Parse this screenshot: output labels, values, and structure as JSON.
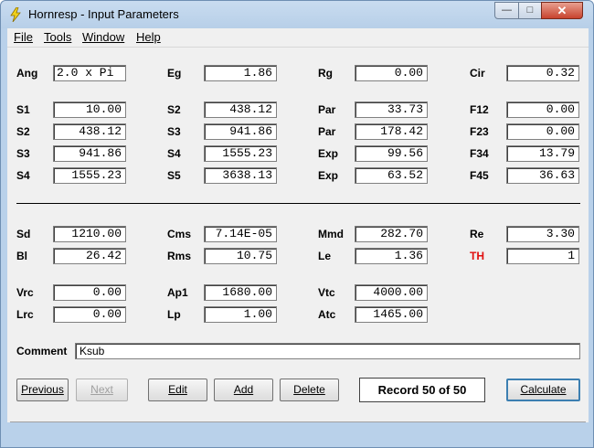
{
  "window": {
    "title": "Hornresp - Input Parameters"
  },
  "menu": [
    {
      "label": "File"
    },
    {
      "label": "Tools"
    },
    {
      "label": "Window"
    },
    {
      "label": "Help"
    }
  ],
  "horn": {
    "row0": [
      {
        "label": "Ang",
        "value": "2.0 x Pi"
      },
      {
        "label": "Eg",
        "value": "1.86"
      },
      {
        "label": "Rg",
        "value": "0.00"
      },
      {
        "label": "Cir",
        "value": "0.32"
      }
    ],
    "rows": [
      [
        {
          "label": "S1",
          "value": "10.00"
        },
        {
          "label": "S2",
          "value": "438.12"
        },
        {
          "label": "Par",
          "value": "33.73"
        },
        {
          "label": "F12",
          "value": "0.00"
        }
      ],
      [
        {
          "label": "S2",
          "value": "438.12"
        },
        {
          "label": "S3",
          "value": "941.86"
        },
        {
          "label": "Par",
          "value": "178.42"
        },
        {
          "label": "F23",
          "value": "0.00"
        }
      ],
      [
        {
          "label": "S3",
          "value": "941.86"
        },
        {
          "label": "S4",
          "value": "1555.23"
        },
        {
          "label": "Exp",
          "value": "99.56"
        },
        {
          "label": "F34",
          "value": "13.79"
        }
      ],
      [
        {
          "label": "S4",
          "value": "1555.23"
        },
        {
          "label": "S5",
          "value": "3638.13"
        },
        {
          "label": "Exp",
          "value": "63.52"
        },
        {
          "label": "F45",
          "value": "36.63"
        }
      ]
    ]
  },
  "driver": {
    "rows": [
      [
        {
          "label": "Sd",
          "value": "1210.00"
        },
        {
          "label": "Cms",
          "value": "7.14E-05"
        },
        {
          "label": "Mmd",
          "value": "282.70"
        },
        {
          "label": "Re",
          "value": "3.30"
        }
      ],
      [
        {
          "label": "Bl",
          "value": "26.42"
        },
        {
          "label": "Rms",
          "value": "10.75"
        },
        {
          "label": "Le",
          "value": "1.36"
        },
        {
          "label": "TH",
          "value": "1"
        }
      ]
    ]
  },
  "chamber": {
    "rows": [
      [
        {
          "label": "Vrc",
          "value": "0.00"
        },
        {
          "label": "Ap1",
          "value": "1680.00"
        },
        {
          "label": "Vtc",
          "value": "4000.00"
        }
      ],
      [
        {
          "label": "Lrc",
          "value": "0.00"
        },
        {
          "label": "Lp",
          "value": "1.00"
        },
        {
          "label": "Atc",
          "value": "1465.00"
        }
      ]
    ]
  },
  "comment": {
    "label": "Comment",
    "value": "Ksub"
  },
  "buttons": {
    "previous": "Previous",
    "next": "Next",
    "edit": "Edit",
    "add": "Add",
    "delete": "Delete",
    "calculate": "Calculate"
  },
  "record": "Record 50 of 50",
  "colors": {
    "th_label": "#e01010",
    "title_bar": "#b9d1ea"
  }
}
